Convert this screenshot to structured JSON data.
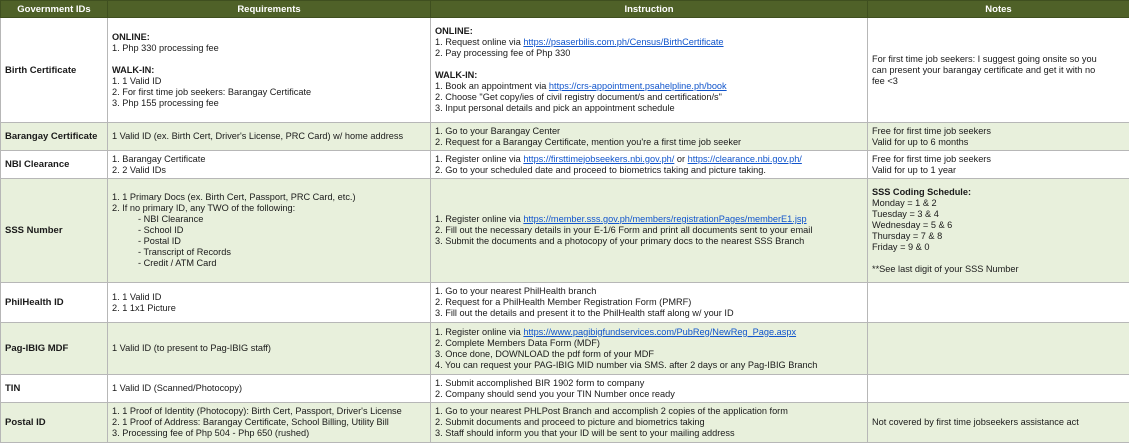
{
  "headers": [
    "Government IDs",
    "Requirements",
    "Instruction",
    "Notes"
  ],
  "rows": [
    {
      "id": "Birth Certificate",
      "req": [
        {
          "t": "ONLINE:",
          "b": true
        },
        {
          "t": "1. Php 330 processing fee"
        },
        {
          "s": true
        },
        {
          "t": "WALK-IN:",
          "b": true
        },
        {
          "t": "1. 1 Valid ID"
        },
        {
          "t": "2. For first time job seekers: Barangay Certificate"
        },
        {
          "t": "3. Php 155 processing fee"
        }
      ],
      "ins": [
        {
          "t": "ONLINE:",
          "b": true
        },
        {
          "t": "1. Request online via ",
          "link": "https://psaserbilis.com.ph/Census/BirthCertificate"
        },
        {
          "t": "2. Pay processing fee of Php 330"
        },
        {
          "s": true
        },
        {
          "t": "WALK-IN:",
          "b": true
        },
        {
          "t": "1. Book an appointment via ",
          "link": "https://crs-appointment.psahelpline.ph/book"
        },
        {
          "t": "2. Choose \"Get copy/ies of civil registry document/s and certification/s\""
        },
        {
          "t": "3. Input personal details and pick an appointment schedule"
        }
      ],
      "notes": [
        {
          "t": "For first time job seekers: I suggest going onsite so you"
        },
        {
          "t": "can present your barangay certificate and get it with no"
        },
        {
          "t": "fee <3"
        }
      ]
    },
    {
      "id": "Barangay Certificate",
      "req": [
        {
          "t": "1 Valid ID (ex. Birth Cert, Driver's License, PRC Card) w/ home address"
        }
      ],
      "ins": [
        {
          "t": "1. Go to your Barangay Center"
        },
        {
          "t": "2. Request for a Barangay Certificate, mention you're a first time job seeker"
        }
      ],
      "notes": [
        {
          "t": "Free for first time job seekers"
        },
        {
          "t": "Valid for up to 6 months"
        }
      ]
    },
    {
      "id": "NBI Clearance",
      "req": [
        {
          "t": "1. Barangay Certificate"
        },
        {
          "t": "2. 2 Valid IDs"
        }
      ],
      "ins": [
        {
          "t": "1. Register online via ",
          "link": "https://firsttimejobseekers.nbi.gov.ph/",
          "mid": " or ",
          "link2": "https://clearance.nbi.gov.ph/"
        },
        {
          "t": "2. Go to your scheduled date and proceed to biometrics taking and picture taking."
        }
      ],
      "notes": [
        {
          "t": "Free for first time job seekers"
        },
        {
          "t": "Valid for up to 1 year"
        }
      ]
    },
    {
      "id": "SSS Number",
      "req": [
        {
          "t": "1. 1 Primary Docs (ex. Birth Cert, Passport, PRC Card, etc.)"
        },
        {
          "t": "2. If no primary ID, any TWO of the following:"
        },
        {
          "t": "-   NBI Clearance",
          "i": true
        },
        {
          "t": "-   School ID",
          "i": true
        },
        {
          "t": "-   Postal ID",
          "i": true
        },
        {
          "t": "-   Transcript of Records",
          "i": true
        },
        {
          "t": "-   Credit / ATM Card",
          "i": true
        }
      ],
      "ins": [
        {
          "t": "1. Register online via ",
          "link": "https://member.sss.gov.ph/members/registrationPages/memberE1.jsp"
        },
        {
          "t": "2. Fill out the necessary details in your E-1/6 Form and print all documents sent to your email"
        },
        {
          "t": "3. Submit the documents and a photocopy of your primary docs to the nearest SSS Branch"
        }
      ],
      "notes": [
        {
          "t": "SSS Coding Schedule:",
          "b": true
        },
        {
          "t": "Monday = 1 & 2"
        },
        {
          "t": "Tuesday = 3 & 4"
        },
        {
          "t": "Wednesday = 5 & 6"
        },
        {
          "t": "Thursday = 7 & 8"
        },
        {
          "t": "Friday = 9 & 0"
        },
        {
          "s": true
        },
        {
          "t": "**See last digit of your SSS Number"
        }
      ]
    },
    {
      "id": "PhilHealth ID",
      "req": [
        {
          "t": "1. 1 Valid ID"
        },
        {
          "t": "2. 1 1x1 Picture"
        }
      ],
      "ins": [
        {
          "t": "1. Go to your nearest PhilHealth branch"
        },
        {
          "t": "2. Request for a PhilHealth Member Registration Form (PMRF)"
        },
        {
          "t": "3. Fill out the details and present it to the PhilHealth staff along w/ your ID"
        }
      ],
      "notes": []
    },
    {
      "id": "Pag-IBIG MDF",
      "req": [
        {
          "t": "1 Valid ID (to present to Pag-IBIG staff)"
        }
      ],
      "ins": [
        {
          "t": "1. Register online via ",
          "link": "https://www.pagibigfundservices.com/PubReg/NewReg_Page.aspx"
        },
        {
          "t": "2. Complete Members Data Form (MDF)"
        },
        {
          "t": "3. Once done, DOWNLOAD the pdf form of your MDF"
        },
        {
          "t": "4. You can request your PAG-IBIG MID number via SMS. after 2 days or any Pag-IBIG Branch"
        }
      ],
      "notes": []
    },
    {
      "id": "TIN",
      "req": [
        {
          "t": "1 Valid ID (Scanned/Photocopy)"
        }
      ],
      "ins": [
        {
          "t": "1. Submit accomplished BIR 1902 form to company"
        },
        {
          "t": "2. Company should send you your TIN Number once ready"
        }
      ],
      "notes": []
    },
    {
      "id": "Postal ID",
      "req": [
        {
          "t": "1. 1 Proof of Identity (Photocopy): Birth Cert, Passport, Driver's License"
        },
        {
          "t": "2. 1 Proof of Address: Barangay Certificate, School Billing, Utility Bill"
        },
        {
          "t": "3. Processing fee of Php 504 - Php 650 (rushed)"
        }
      ],
      "ins": [
        {
          "t": "1. Go to your nearest PHLPost Branch and accomplish 2 copies of the application form"
        },
        {
          "t": "2. Submit documents and proceed to picture and biometrics taking"
        },
        {
          "t": "3. Staff should inform you that your ID will be sent to your mailing address"
        }
      ],
      "notes": [
        {
          "t": "Not covered by first time jobseekers assistance act"
        }
      ]
    }
  ]
}
